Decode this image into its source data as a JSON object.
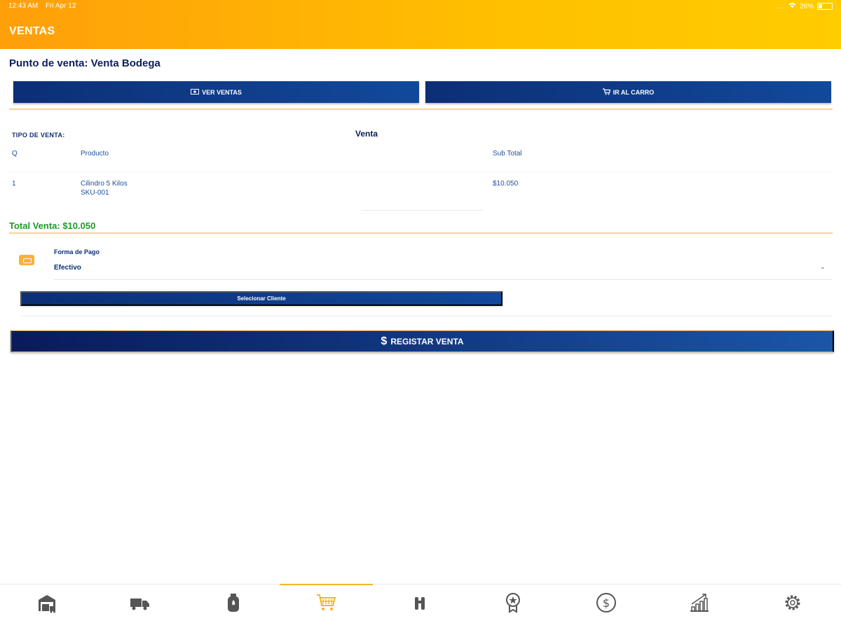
{
  "status_bar": {
    "time": "12:43 AM",
    "date": "Fri Apr 12",
    "signal": "....",
    "battery_percent": "26%",
    "battery_level": 0.26
  },
  "header": {
    "title": "VENTAS"
  },
  "page": {
    "title": "Punto de venta: Venta Bodega"
  },
  "actions": {
    "ver_ventas": "VER VENTAS",
    "ir_al_carro": "IR AL CARRO"
  },
  "sale": {
    "tipo_label": "TIPO DE VENTA:",
    "tipo_value": "Venta",
    "columns": {
      "qty": "Q",
      "product": "Producto",
      "subtotal": "Sub Total"
    },
    "items": [
      {
        "qty": "1",
        "product": "Cilindro 5 Kilos",
        "sku": "SKU-001",
        "subtotal": "$10.050"
      }
    ],
    "total": "Total Venta: $10.050"
  },
  "payment": {
    "label": "Forma de Pago",
    "value": "Efectivo"
  },
  "cliente_button": "Selecionar Cliente",
  "register_button": "REGISTAR VENTA",
  "tabbar": {
    "active_color": "#f5b52b",
    "icon_color": "#555555",
    "items": [
      {
        "icon": "warehouse-icon",
        "active": false
      },
      {
        "icon": "truck-icon",
        "active": false
      },
      {
        "icon": "gas-cylinder-icon",
        "active": false
      },
      {
        "icon": "cart-icon",
        "active": true
      },
      {
        "icon": "binoculars-icon",
        "active": false
      },
      {
        "icon": "award-icon",
        "active": false
      },
      {
        "icon": "dollar-icon",
        "active": false
      },
      {
        "icon": "chart-icon",
        "active": false
      },
      {
        "icon": "settings-icon",
        "active": false
      }
    ]
  }
}
